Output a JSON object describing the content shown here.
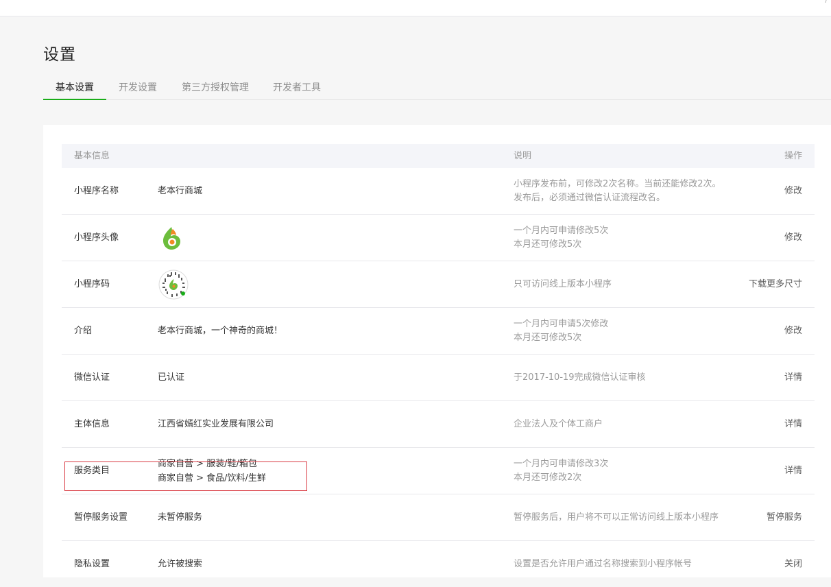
{
  "page": {
    "title": "设置"
  },
  "tabs": [
    {
      "label": "基本设置",
      "active": true
    },
    {
      "label": "开发设置",
      "active": false
    },
    {
      "label": "第三方授权管理",
      "active": false
    },
    {
      "label": "开发者工具",
      "active": false
    }
  ],
  "table": {
    "headers": {
      "info": "基本信息",
      "desc": "说明",
      "action": "操作"
    },
    "rows": [
      {
        "label": "小程序名称",
        "value": [
          "老本行商城"
        ],
        "desc": [
          "小程序发布前，可修改2次名称。当前还能修改2次。",
          "发布后，必须通过微信认证流程改名。"
        ],
        "action": "修改"
      },
      {
        "label": "小程序头像",
        "value": [],
        "desc": [
          "一个月内可申请修改5次",
          "本月还可修改5次"
        ],
        "action": "修改"
      },
      {
        "label": "小程序码",
        "value": [],
        "desc": [
          "只可访问线上版本小程序"
        ],
        "action": "下载更多尺寸"
      },
      {
        "label": "介绍",
        "value": [
          "老本行商城，一个神奇的商城！"
        ],
        "desc": [
          "一个月内可申请5次修改",
          "本月还可修改5次"
        ],
        "action": "修改"
      },
      {
        "label": "微信认证",
        "value": [
          "已认证"
        ],
        "desc": [
          "于2017-10-19完成微信认证审核"
        ],
        "action": "详情"
      },
      {
        "label": "主体信息",
        "value": [
          "江西省嫣红实业发展有限公司"
        ],
        "desc": [
          "企业法人及个体工商户"
        ],
        "action": "详情"
      },
      {
        "label": "服务类目",
        "value": [
          "商家自营 > 服装/鞋/箱包",
          "商家自营 > 食品/饮料/生鲜"
        ],
        "desc": [
          "一个月内可申请修改3次",
          "本月还可修改2次"
        ],
        "action": "详情"
      },
      {
        "label": "暂停服务设置",
        "value": [
          "未暂停服务"
        ],
        "desc": [
          "暂停服务后，用户将不可以正常访问线上版本小程序"
        ],
        "action": "暂停服务"
      },
      {
        "label": "隐私设置",
        "value": [
          "允许被搜索"
        ],
        "desc": [
          "设置是否允许用户通过名称搜索到小程序帐号"
        ],
        "action": "关闭"
      }
    ]
  },
  "colors": {
    "accent": "#1aad19",
    "highlight": "#d9363e",
    "logo_green": "#6cbd3c",
    "logo_orange": "#f08a24"
  },
  "icons": {
    "avatar": "app-logo-icon",
    "qrcode": "mini-program-code-icon"
  }
}
